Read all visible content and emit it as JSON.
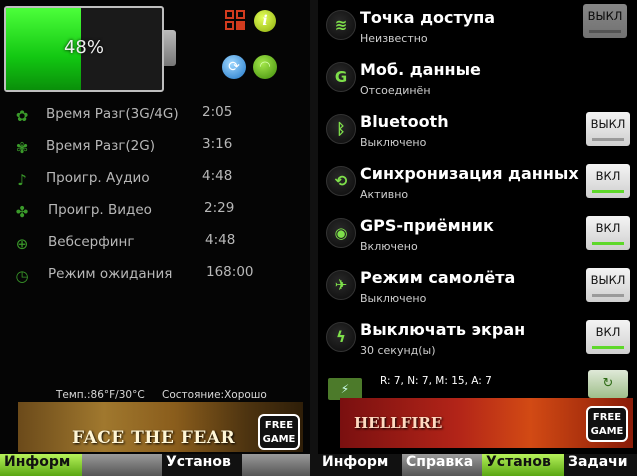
{
  "left": {
    "battery": {
      "percent_label": "48%",
      "level": 48
    },
    "usage": [
      {
        "icon": "chat-bubble-icon",
        "label": "Время Разг(3G/4G)",
        "value": "2:05"
      },
      {
        "icon": "chat-bubbles-icon",
        "label": "Время Разг(2G)",
        "value": "3:16"
      },
      {
        "icon": "music-note-icon",
        "label": "Проигр. Аудио",
        "value": "4:48"
      },
      {
        "icon": "film-reel-icon",
        "label": "Проигр. Видео",
        "value": "2:29"
      },
      {
        "icon": "globe-icon",
        "label": "Вебсерфинг",
        "value": "4:48"
      },
      {
        "icon": "clock-icon",
        "label": "Режим ожидания",
        "value": "168:00"
      }
    ],
    "temperature": "Темп.:86°F/30°C",
    "condition": "Состояние:Хорошо",
    "ad": {
      "title": "FACE THE FEAR",
      "badge_line1": "FREE",
      "badge_line2": "GAME"
    },
    "tabs": [
      "Информ",
      "",
      "Установ"
    ]
  },
  "right": {
    "toggles": [
      {
        "icon": "wifi-hotspot-icon",
        "title": "Точка доступа",
        "subtitle": "Неизвестно",
        "button": "ВЫКЛ",
        "on": false
      },
      {
        "icon": "mobile-data-icon",
        "glyph": "G",
        "title": "Моб. данные",
        "subtitle": "Отсоединён",
        "button": "",
        "on": false
      },
      {
        "icon": "bluetooth-icon",
        "title": "Bluetooth",
        "subtitle": "Выключено",
        "button": "ВЫКЛ",
        "on": false
      },
      {
        "icon": "sync-icon",
        "title": "Синхронизация данных",
        "subtitle": "Активно",
        "button": "ВКЛ",
        "on": true
      },
      {
        "icon": "gps-icon",
        "title": "GPS-приёмник",
        "subtitle": "Включено",
        "button": "ВКЛ",
        "on": true
      },
      {
        "icon": "airplane-icon",
        "title": "Режим самолёта",
        "subtitle": "Выключено",
        "button": "ВЫКЛ",
        "on": false
      },
      {
        "icon": "lightning-icon",
        "title": "Выключать экран",
        "subtitle": "30 секунд(ы)",
        "button": "ВКЛ",
        "on": true
      }
    ],
    "stats": "R: 7, N: 7, M: 15, A: 7",
    "ad": {
      "title": "HELLFIRE",
      "badge_line1": "FREE",
      "badge_line2": "GAME"
    },
    "tabs": [
      "Информ",
      "Справка",
      "Установ",
      "Задачи"
    ]
  }
}
